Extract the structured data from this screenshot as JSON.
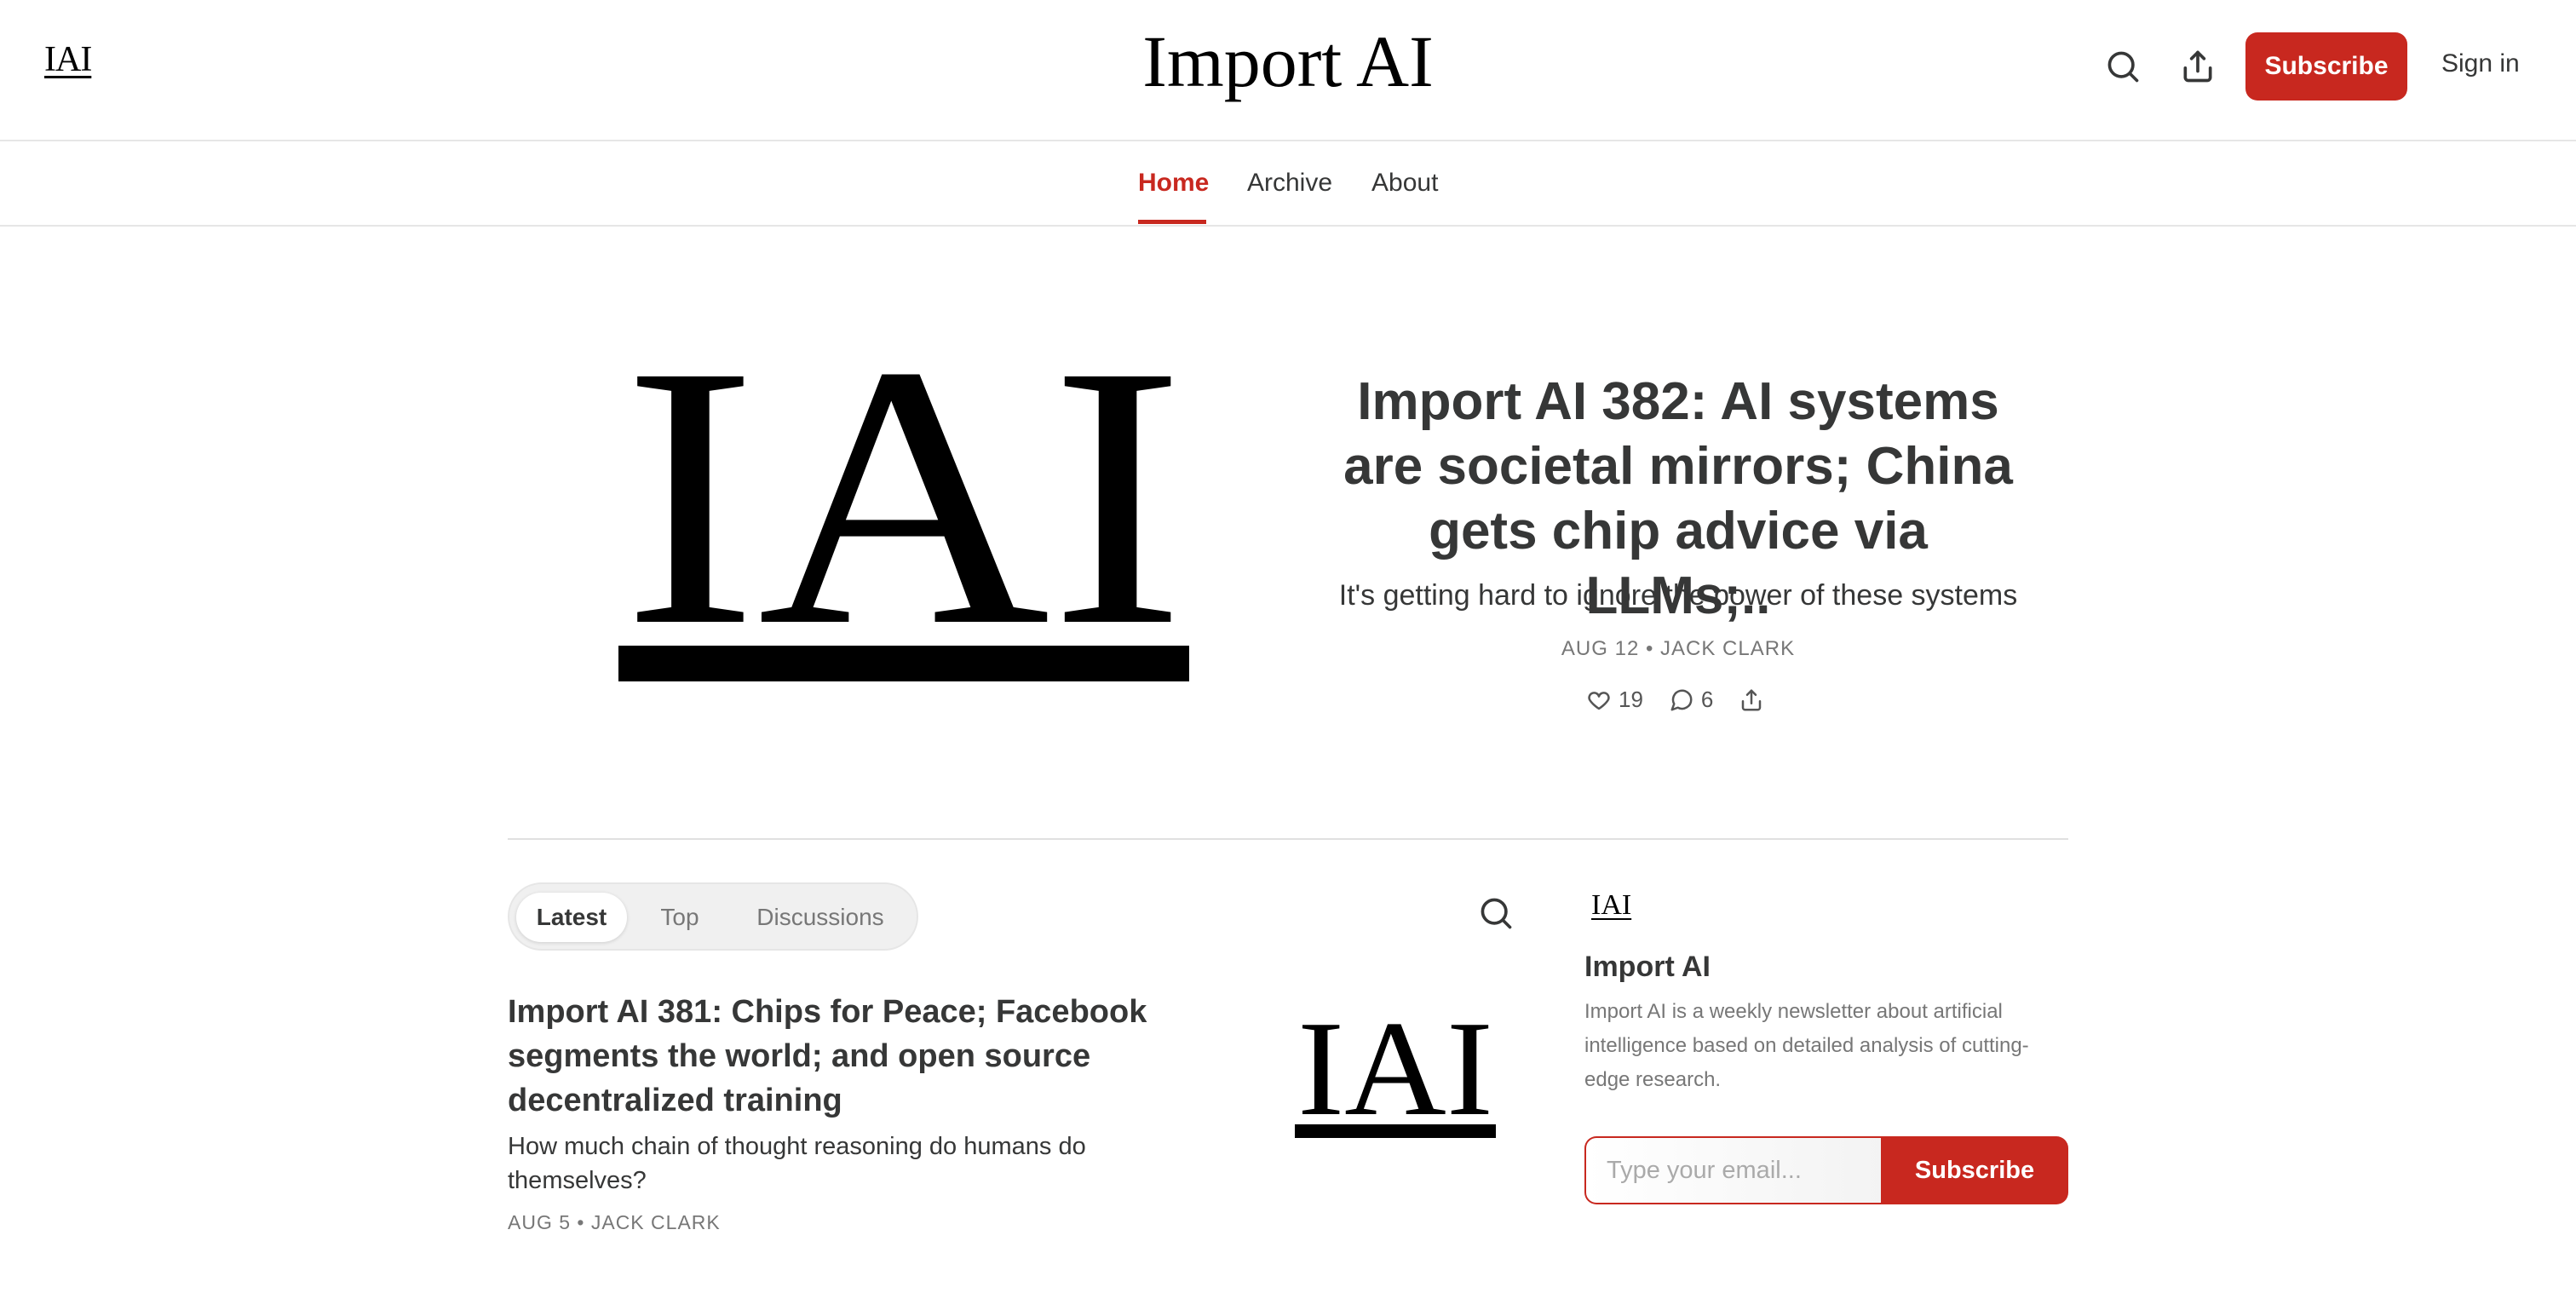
{
  "header": {
    "logo_text": "IAI",
    "site_title": "Import AI",
    "search_icon": "search-icon",
    "share_icon": "share-icon",
    "subscribe_label": "Subscribe",
    "signin_label": "Sign in"
  },
  "nav": {
    "items": [
      {
        "label": "Home",
        "active": true
      },
      {
        "label": "Archive",
        "active": false
      },
      {
        "label": "About",
        "active": false
      }
    ]
  },
  "hero": {
    "logo_text": "IAI",
    "title": "Import AI 382: AI systems are societal mirrors; China gets chip advice via LLMs;..",
    "subtitle": "It's getting hard to ignore the power of these systems",
    "meta": "AUG 12 • JACK CLARK",
    "likes": "19",
    "comments": "6"
  },
  "tabs": {
    "items": [
      "Latest",
      "Top",
      "Discussions"
    ],
    "active": "Latest"
  },
  "post": {
    "title": "Import AI 381: Chips for Peace; Facebook segments the world; and open source decentralized training",
    "subtitle": "How much chain of thought reasoning do humans do themselves?",
    "meta": "AUG 5 • JACK CLARK",
    "thumb_text": "IAI"
  },
  "sidebar": {
    "logo_text": "IAI",
    "title": "Import AI",
    "description": "Import AI is a weekly newsletter about artificial intelligence based on detailed analysis of cutting-edge research.",
    "email_placeholder": "Type your email...",
    "subscribe_label": "Subscribe"
  },
  "colors": {
    "accent": "#c8281f",
    "text": "#363737",
    "muted": "#777777"
  }
}
